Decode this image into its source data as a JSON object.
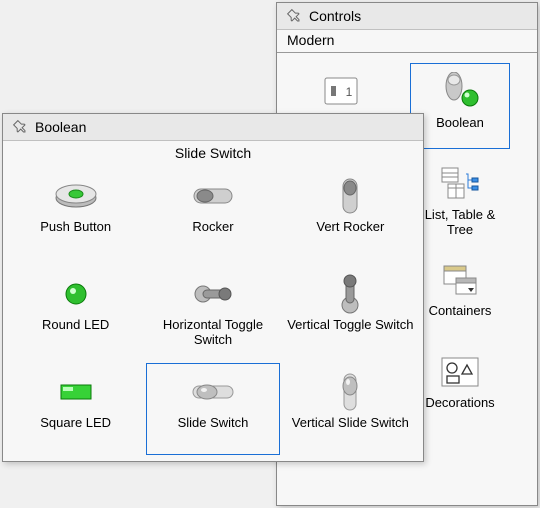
{
  "controls": {
    "title": "Controls",
    "subcategory": "Modern",
    "items": [
      {
        "label": "",
        "icon": "numeric-thumb-icon",
        "selected": false
      },
      {
        "label": "Boolean",
        "icon": "boolean-thumb-icon",
        "selected": true
      },
      {
        "label": "List, Table & Tree",
        "icon": "list-tree-thumb-icon",
        "selected": false
      },
      {
        "label": "Containers",
        "icon": "containers-thumb-icon",
        "selected": false
      },
      {
        "label": "Decorations",
        "icon": "decorations-thumb-icon",
        "selected": false
      }
    ]
  },
  "boolean": {
    "title": "Boolean",
    "category_label": "Slide Switch",
    "items": [
      {
        "label": "Push Button",
        "icon": "push-button-icon",
        "selected": false
      },
      {
        "label": "Rocker",
        "icon": "rocker-icon",
        "selected": false
      },
      {
        "label": "Vert Rocker",
        "icon": "vert-rocker-icon",
        "selected": false
      },
      {
        "label": "Round LED",
        "icon": "round-led-icon",
        "selected": false
      },
      {
        "label": "Horizontal Toggle Switch",
        "icon": "h-toggle-icon",
        "selected": false
      },
      {
        "label": "Vertical Toggle Switch",
        "icon": "v-toggle-icon",
        "selected": false
      },
      {
        "label": "Square LED",
        "icon": "square-led-icon",
        "selected": false
      },
      {
        "label": "Slide Switch",
        "icon": "slide-switch-icon",
        "selected": true
      },
      {
        "label": "Vertical Slide Switch",
        "icon": "v-slide-switch-icon",
        "selected": false
      }
    ]
  }
}
